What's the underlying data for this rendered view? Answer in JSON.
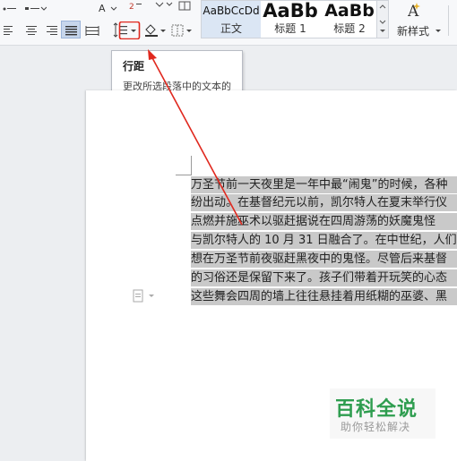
{
  "ribbon": {
    "style_gallery": {
      "styles": [
        {
          "sample": "AaBbCcDd",
          "label": "正文",
          "active": true
        },
        {
          "sample": "AaBb",
          "label": "标题 1",
          "active": false
        },
        {
          "sample": "AaBb",
          "label": "标题 2",
          "active": false
        }
      ]
    },
    "new_style": {
      "label": "新样式"
    }
  },
  "tooltip": {
    "title": "行距",
    "description": "更改所选段落中的文本的行间距。"
  },
  "document": {
    "lines": [
      "万圣节前一天夜里是一年中最“闹鬼”的时候，各种",
      "纷出动。在基督纪元以前，凯尔特人在夏末举行仪",
      "点燃并施巫术以驱赶据说在四周游荡的妖魔鬼怪",
      "与凯尔特人的 10 月 31 日融合了。在中世纪，人们",
      "想在万圣节前夜驱赶黑夜中的鬼怪。尽管后来基督",
      "的习俗还是保留下来了。孩子们带着开玩笑的心态",
      "这些舞会四周的墙上往往悬挂着用纸糊的巫婆、黑"
    ]
  },
  "watermark": {
    "title": "百科全说",
    "subtitle": "助你轻松解决"
  },
  "colors": {
    "selection": "#c9c9c9",
    "annotation": "#e0281e",
    "watermark": "#2e9d4f"
  }
}
